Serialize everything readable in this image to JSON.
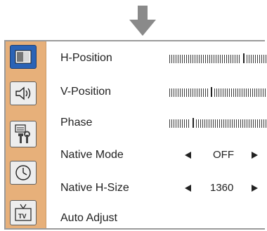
{
  "menu": {
    "items": [
      {
        "label": "H-Position",
        "type": "slider",
        "position": 0.85
      },
      {
        "label": "V-Position",
        "type": "slider",
        "position": 0.55
      },
      {
        "label": "Phase",
        "type": "slider",
        "position": 0.25
      },
      {
        "label": "Native Mode",
        "type": "option",
        "value": "OFF"
      },
      {
        "label": "Native H-Size",
        "type": "option",
        "value": "1360"
      },
      {
        "label": "Auto Adjust",
        "type": "action"
      }
    ]
  },
  "sidebar": {
    "icons": [
      "picture-icon",
      "speaker-icon",
      "setup-tools-icon",
      "clock-icon",
      "tv-icon"
    ],
    "active": "picture-icon"
  },
  "colors": {
    "sidebar": "#e7b07a",
    "active_icon": "#2b63b6",
    "arrow": "#8a8a8a"
  }
}
